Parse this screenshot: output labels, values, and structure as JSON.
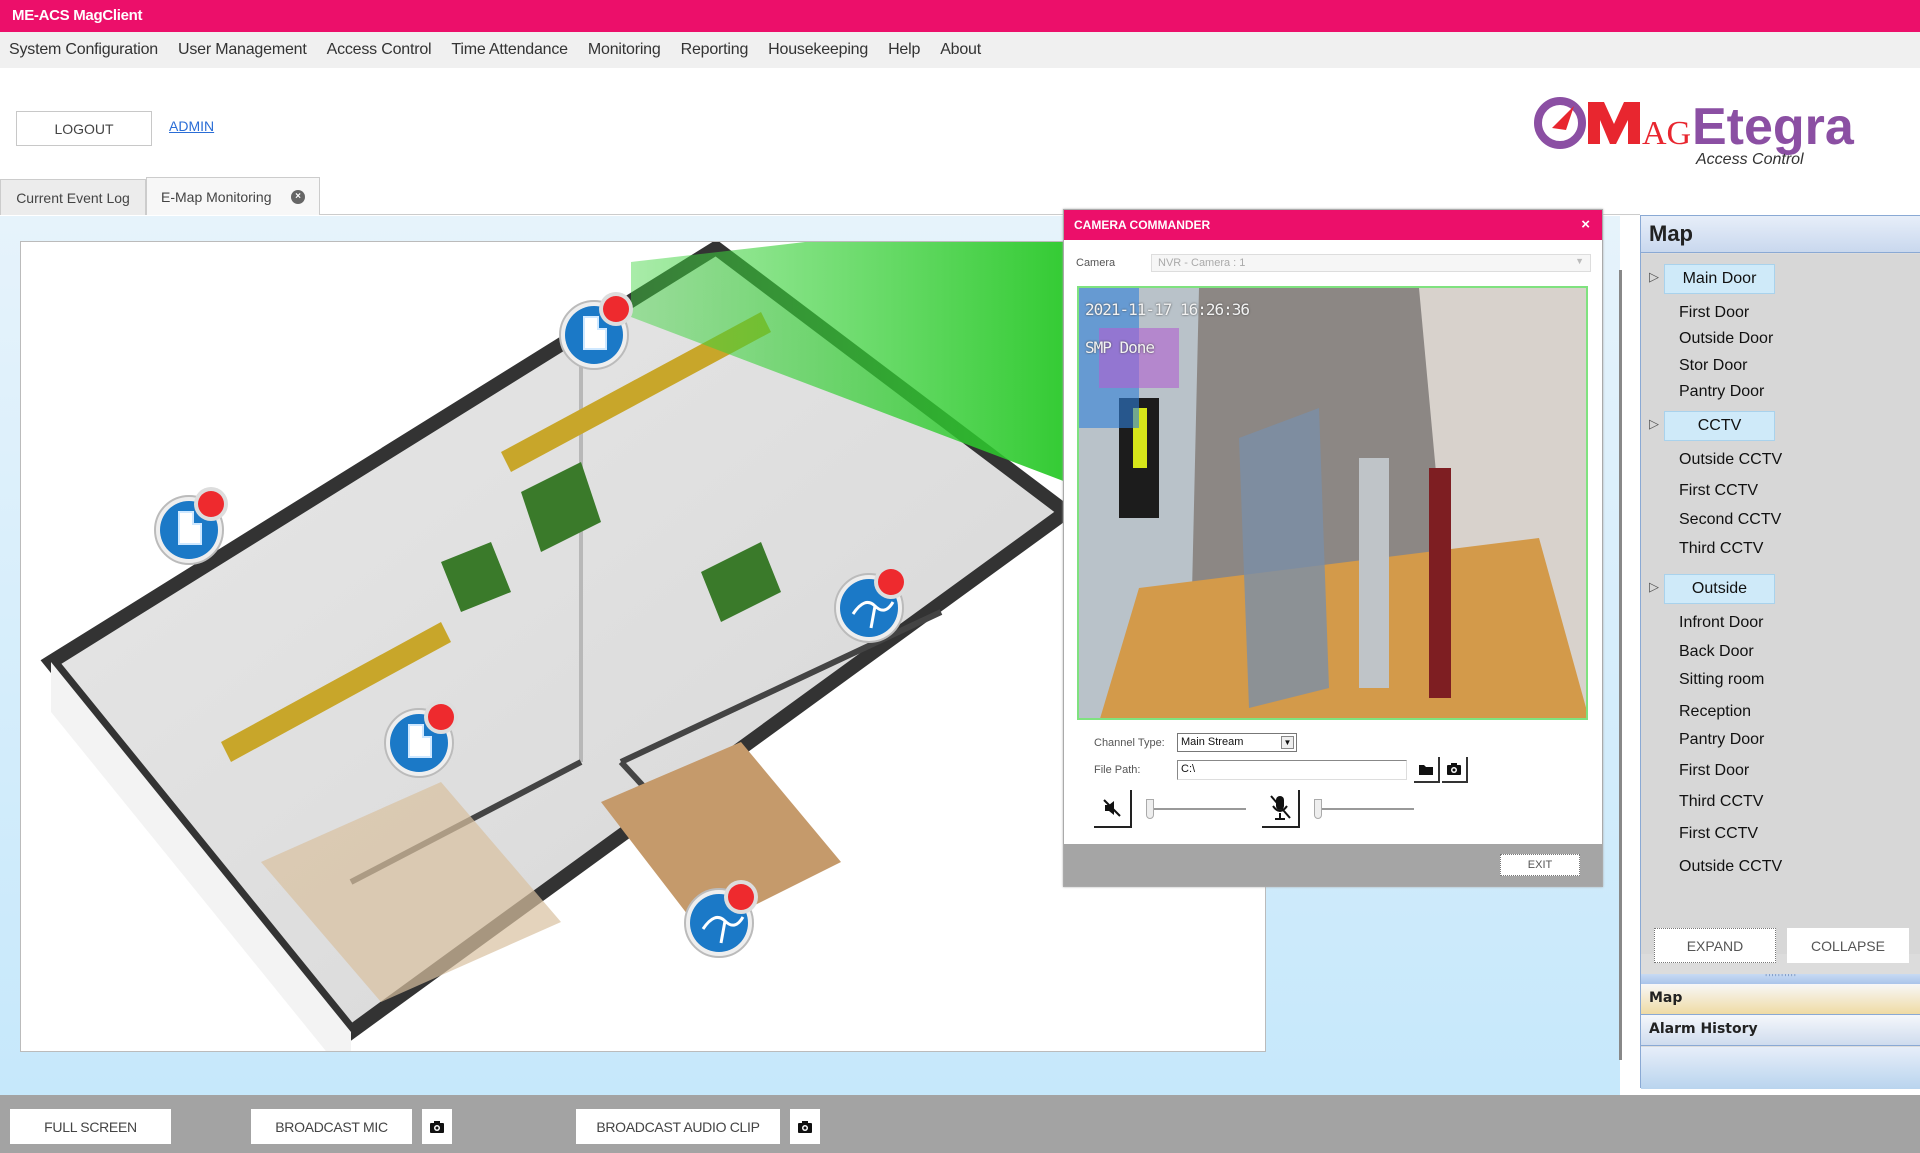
{
  "app": {
    "title": "ME-ACS MagClient"
  },
  "menu": [
    "System Configuration",
    "User Management",
    "Access Control",
    "Time Attendance",
    "Monitoring",
    "Reporting",
    "Housekeeping",
    "Help",
    "About"
  ],
  "header": {
    "logout_label": "LOGOUT",
    "user_link": "ADMIN",
    "logo_text": "MAGEtegra",
    "logo_subtitle": "Access Control"
  },
  "tabs": [
    {
      "label": "Current Event Log",
      "active": false
    },
    {
      "label": "E-Map Monitoring",
      "active": true,
      "closable": true
    }
  ],
  "emap": {
    "markers": [
      {
        "type": "door",
        "alarm": true
      },
      {
        "type": "door",
        "alarm": true
      },
      {
        "type": "cctv",
        "alarm": true
      },
      {
        "type": "door",
        "alarm": true
      },
      {
        "type": "cctv",
        "alarm": true
      }
    ],
    "highlight_color": "#3fd43f"
  },
  "camera_dialog": {
    "title": "CAMERA COMMANDER",
    "camera_label": "Camera",
    "camera_value": "NVR - Camera : 1",
    "video_overlay_time": "2021-11-17 16:26:36",
    "video_overlay_name": "SMP Done",
    "channel_type_label": "Channel Type:",
    "channel_type_value": "Main Stream",
    "file_path_label": "File Path:",
    "file_path_value": "C:\\",
    "speaker_volume": 0,
    "mic_volume": 0,
    "exit_label": "EXIT"
  },
  "map_panel": {
    "title": "Map",
    "groups": [
      {
        "label": "Main Door",
        "items": [
          "First Door",
          "Outside Door",
          "Stor Door",
          "Pantry Door"
        ]
      },
      {
        "label": "CCTV",
        "items": [
          "Outside CCTV",
          "First CCTV",
          "Second CCTV",
          "Third CCTV"
        ]
      },
      {
        "label": "Outside",
        "items": [
          "Infront Door",
          "Back Door",
          "Sitting room",
          "Reception",
          "Pantry Door",
          "First Door",
          "Third CCTV",
          "First CCTV",
          "Outside CCTV"
        ]
      }
    ],
    "expand_label": "EXPAND",
    "collapse_label": "COLLAPSE",
    "accordion": [
      "Map",
      "Alarm History"
    ]
  },
  "bottom_bar": {
    "full_screen": "FULL SCREEN",
    "broadcast_mic": "BROADCAST MIC",
    "broadcast_audio_clip": "BROADCAST AUDIO CLIP"
  },
  "colors": {
    "brand": "#ec0f6a",
    "logo_purple": "#8b4fa3",
    "logo_red": "#e8262f",
    "workspace": "#c6e8fb"
  }
}
